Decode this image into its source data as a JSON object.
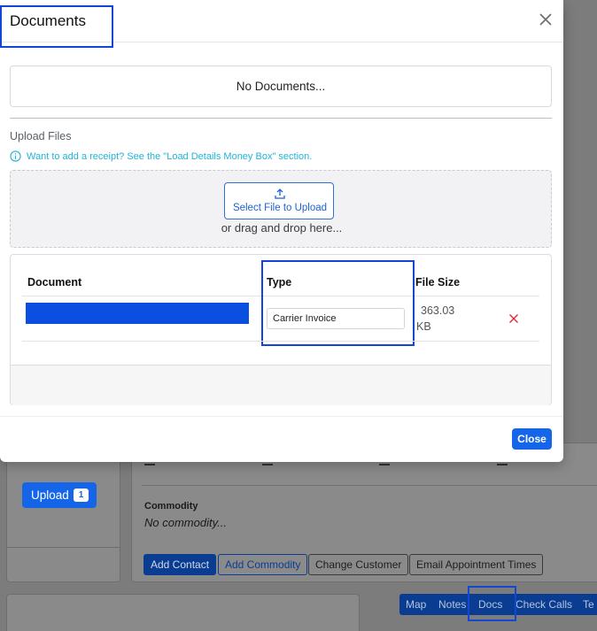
{
  "background": {
    "commodity_label": "Commodity",
    "commodity_value": "No commodity...",
    "buttons": {
      "add_contact": "Add Contact",
      "add_commodity": "Add Commodity",
      "change_customer": "Change Customer",
      "email_appointment_times": "Email Appointment Times"
    },
    "tabs": [
      "Map",
      "Notes",
      "Docs",
      "Check Calls",
      "Te"
    ]
  },
  "modal": {
    "title": "Documents",
    "no_documents_text": "No Documents...",
    "upload_section_label": "Upload Files",
    "info_text": "Want to add a receipt? See the \"Load Details Money Box\" section.",
    "select_file_label": "Select File to Upload",
    "drag_drop_text": "or drag and drop here...",
    "table": {
      "headers": {
        "document": "Document",
        "type": "Type",
        "file_size": "File Size"
      },
      "rows": [
        {
          "type": "Carrier Invoice",
          "size_value": "363.03",
          "size_unit": "KB"
        }
      ]
    },
    "upload_button_label": "Upload",
    "upload_count": "1",
    "close_button_label": "Close"
  },
  "colors": {
    "primary": "#1565e8",
    "info": "#22b4d6",
    "danger": "#e0313c",
    "highlight": "#1446d6"
  }
}
